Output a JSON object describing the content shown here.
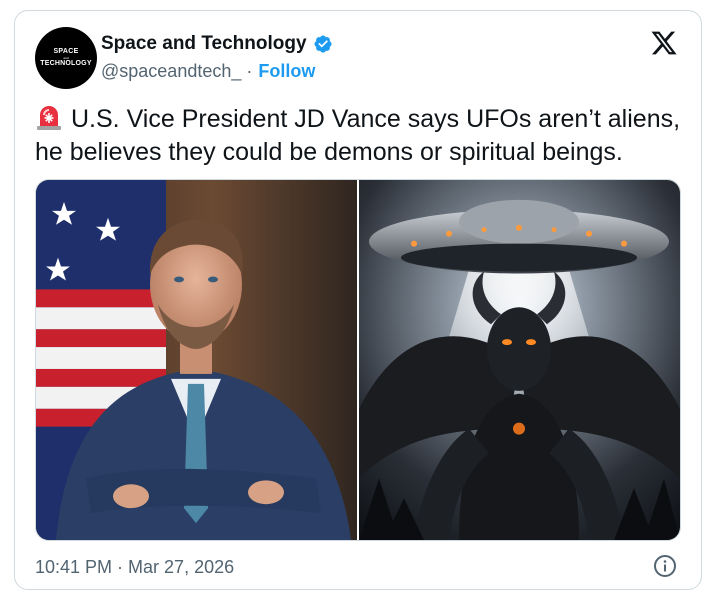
{
  "author": {
    "avatar_line1": "SPACE",
    "avatar_line2": "and",
    "avatar_line3": "TECHNOLOGY",
    "name": "Space and Technology",
    "handle": "@spaceandtech_",
    "separator": "·",
    "follow_label": "Follow",
    "verified_icon": "verified-badge-icon"
  },
  "platform_icon": "x-logo-icon",
  "tweet": {
    "emoji_icon": "siren-icon",
    "line1": "U.S. Vice President JD Vance says UFOs aren’t aliens,",
    "line2": "he believes they could be demons or spiritual beings."
  },
  "media": {
    "left_image": "portrait-photo-man-in-suit-with-flag",
    "right_image": "illustration-ufo-over-horned-demon"
  },
  "footer": {
    "timestamp": "10:41 PM · Mar 27, 2026",
    "info_icon": "info-icon"
  },
  "colors": {
    "link_blue": "#1d9bf0",
    "verified_blue": "#1d9bf0",
    "text_primary": "#0f1419",
    "text_secondary": "#536471",
    "border": "#cfd9de"
  }
}
